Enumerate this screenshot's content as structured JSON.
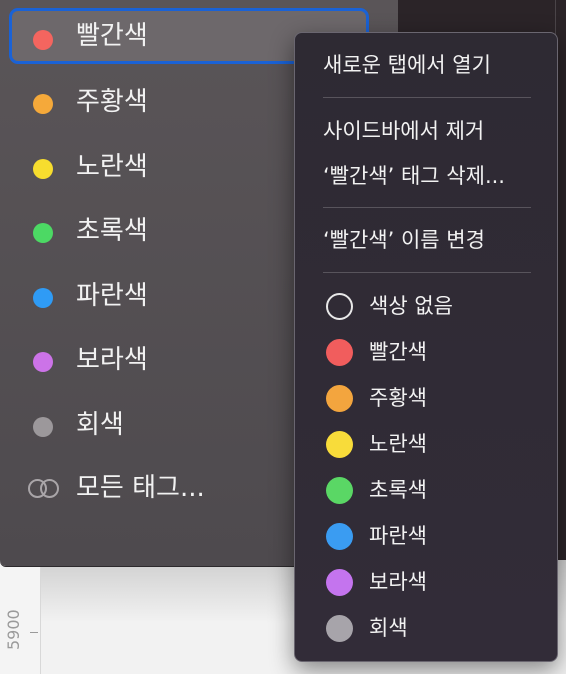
{
  "background": {
    "ruler_label": "5900"
  },
  "sidebar": {
    "items": [
      {
        "label": "빨간색",
        "color": "#f4655f",
        "selected": true
      },
      {
        "label": "주황색",
        "color": "#f5a93a",
        "selected": false
      },
      {
        "label": "노란색",
        "color": "#f7dd2e",
        "selected": false
      },
      {
        "label": "초록색",
        "color": "#4cd964",
        "selected": false
      },
      {
        "label": "파란색",
        "color": "#2f9bf5",
        "selected": false
      },
      {
        "label": "보라색",
        "color": "#cc73e8",
        "selected": false
      },
      {
        "label": "회색",
        "color": "#9c989b",
        "selected": false
      }
    ],
    "all_tags_label": "모든 태그..."
  },
  "context_menu": {
    "open_in_new_tab": "새로운 탭에서 열기",
    "remove_from_sidebar": "사이드바에서 제거",
    "delete_tag": "‘빨간색’ 태그 삭제...",
    "rename_tag": "‘빨간색’ 이름 변경",
    "colors": [
      {
        "label": "색상 없음",
        "color": "none"
      },
      {
        "label": "빨간색",
        "color": "#f15d5d"
      },
      {
        "label": "주황색",
        "color": "#f3a53e"
      },
      {
        "label": "노란색",
        "color": "#f8dc3a"
      },
      {
        "label": "초록색",
        "color": "#5ad765"
      },
      {
        "label": "파란색",
        "color": "#3a9cf2"
      },
      {
        "label": "보라색",
        "color": "#c474ee"
      },
      {
        "label": "회색",
        "color": "#a7a4aa"
      }
    ]
  }
}
